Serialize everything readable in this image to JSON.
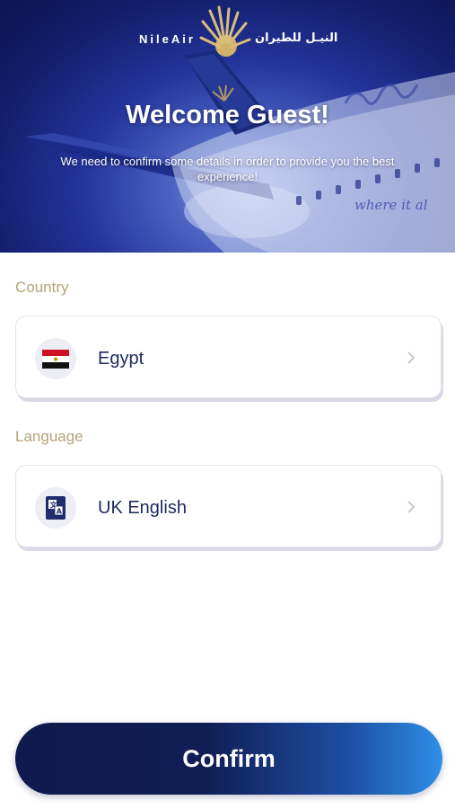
{
  "header": {
    "brand_en": "NileAir",
    "brand_ar": "النيـل للطيران",
    "welcome": "Welcome Guest!",
    "subtitle": "We need to confirm some details in order to provide you the best experience!",
    "tagline": "where it al"
  },
  "country": {
    "label": "Country",
    "value": "Egypt",
    "icon": "egypt-flag-icon"
  },
  "language": {
    "label": "Language",
    "value": "UK English",
    "icon": "language-icon"
  },
  "actions": {
    "confirm_label": "Confirm"
  },
  "colors": {
    "accent_gold": "#b6a378",
    "navy": "#1d2a5c",
    "button_start": "#0f1a4d",
    "button_end": "#2f8ee6"
  }
}
